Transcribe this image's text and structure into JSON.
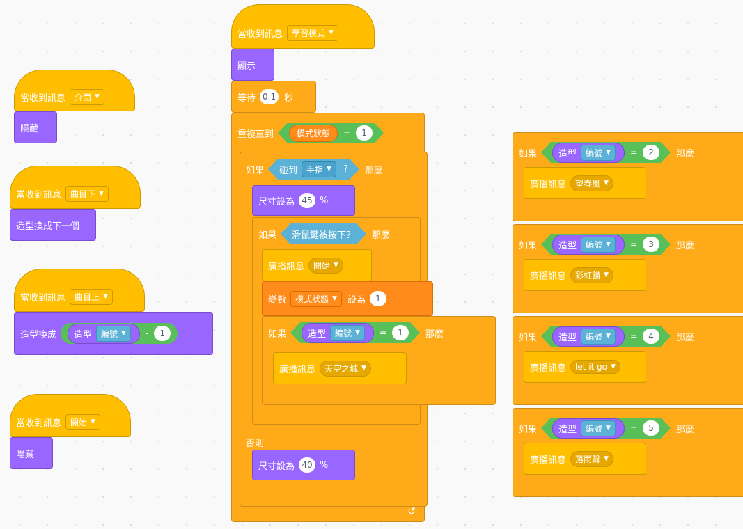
{
  "scripts": {
    "s1": {
      "hat": "當收到訊息",
      "msg": "介面",
      "action": "隱藏"
    },
    "s2": {
      "hat": "當收到訊息",
      "msg": "曲目下",
      "action": "造型換成下一個"
    },
    "s3": {
      "hat": "當收到訊息",
      "msg": "曲目上",
      "action": "造型換成",
      "costume": "造型",
      "field": "編號",
      "op": "-",
      "num": "1"
    },
    "s4": {
      "hat": "當收到訊息",
      "msg": "開始",
      "action": "隱藏"
    }
  },
  "main": {
    "hat": "當收到訊息",
    "msg": "學習模式",
    "show": "顯示",
    "wait": "等待",
    "wait_val": "0.1",
    "wait_unit": "秒",
    "repeat": "重複直到",
    "rep_var": "模式狀態",
    "eq": "=",
    "rep_val": "1",
    "if": "如果",
    "then": "那麼",
    "touch": "碰到",
    "touch_obj": "手指",
    "q": "?",
    "size_set": "尺寸設為",
    "size1": "45",
    "pct": "%",
    "mouse": "滑鼠鍵被按下？",
    "bcast": "廣播訊息",
    "bcast1": "開始",
    "var": "變數",
    "var_name": "模式狀態",
    "set_to": "設為",
    "var_val": "1",
    "costume": "造型",
    "field": "編號",
    "c_val": "1",
    "bcast2": "天空之城",
    "else": "否則",
    "size2": "40"
  },
  "right": [
    {
      "if": "如果",
      "costume": "造型",
      "field": "編號",
      "eq": "=",
      "val": "2",
      "then": "那麼",
      "bcast": "廣播訊息",
      "msg": "望春風"
    },
    {
      "if": "如果",
      "costume": "造型",
      "field": "編號",
      "eq": "=",
      "val": "3",
      "then": "那麼",
      "bcast": "廣播訊息",
      "msg": "彩虹貓"
    },
    {
      "if": "如果",
      "costume": "造型",
      "field": "編號",
      "eq": "=",
      "val": "4",
      "then": "那麼",
      "bcast": "廣播訊息",
      "msg": "let it go"
    },
    {
      "if": "如果",
      "costume": "造型",
      "field": "編號",
      "eq": "=",
      "val": "5",
      "then": "那麼",
      "bcast": "廣播訊息",
      "msg": "落雨聲"
    }
  ]
}
